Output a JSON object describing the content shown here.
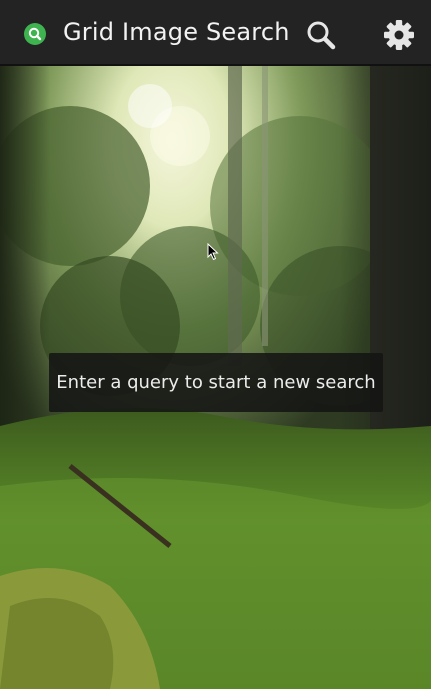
{
  "action_bar": {
    "title": "Grid Image Search",
    "app_icon": "magnifier-logo-icon",
    "search_icon": "search-icon",
    "settings_icon": "gear-icon",
    "accent_color": "#3fb34f",
    "background_color": "#232323"
  },
  "main": {
    "background": "forest-photo",
    "toast": {
      "text": "Enter a query to start a new search"
    }
  }
}
